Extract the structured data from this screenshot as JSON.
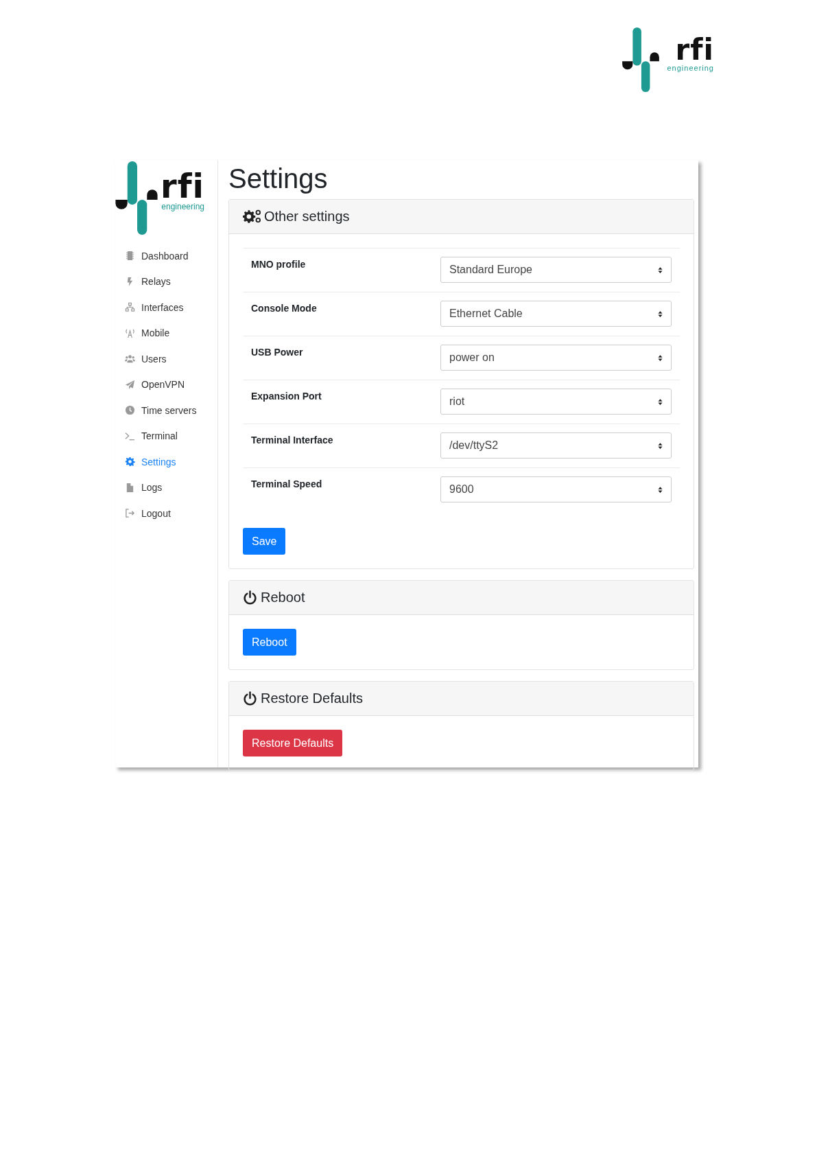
{
  "page_logo": {
    "wordmark": "rfi",
    "tagline": "engineering"
  },
  "app": {
    "sidebar": {
      "logo": {
        "wordmark": "rfi",
        "tagline": "engineering"
      },
      "items": [
        {
          "label": "Dashboard",
          "selected": false
        },
        {
          "label": "Relays",
          "selected": false
        },
        {
          "label": "Interfaces",
          "selected": false
        },
        {
          "label": "Mobile",
          "selected": false
        },
        {
          "label": "Users",
          "selected": false
        },
        {
          "label": "OpenVPN",
          "selected": false
        },
        {
          "label": "Time servers",
          "selected": false
        },
        {
          "label": "Terminal",
          "selected": false
        },
        {
          "label": "Settings",
          "selected": true
        },
        {
          "label": "Logs",
          "selected": false
        },
        {
          "label": "Logout",
          "selected": false
        }
      ]
    },
    "title": "Settings",
    "panels": [
      {
        "kind": "form",
        "title": "Other settings",
        "fields": [
          {
            "label": "MNO profile",
            "value": "Standard Europe"
          },
          {
            "label": "Console Mode",
            "value": "Ethernet Cable"
          },
          {
            "label": "USB Power",
            "value": "power on"
          },
          {
            "label": "Expansion Port",
            "value": "riot"
          },
          {
            "label": "Terminal Interface",
            "value": "/dev/ttyS2"
          },
          {
            "label": "Terminal Speed",
            "value": "9600"
          }
        ],
        "button": {
          "label": "Save",
          "kind": "primary"
        }
      },
      {
        "kind": "action",
        "title": "Reboot",
        "button": {
          "label": "Reboot",
          "kind": "primary"
        }
      },
      {
        "kind": "action",
        "title": "Restore Defaults",
        "button": {
          "label": "Restore Defaults",
          "kind": "danger"
        }
      }
    ]
  }
}
